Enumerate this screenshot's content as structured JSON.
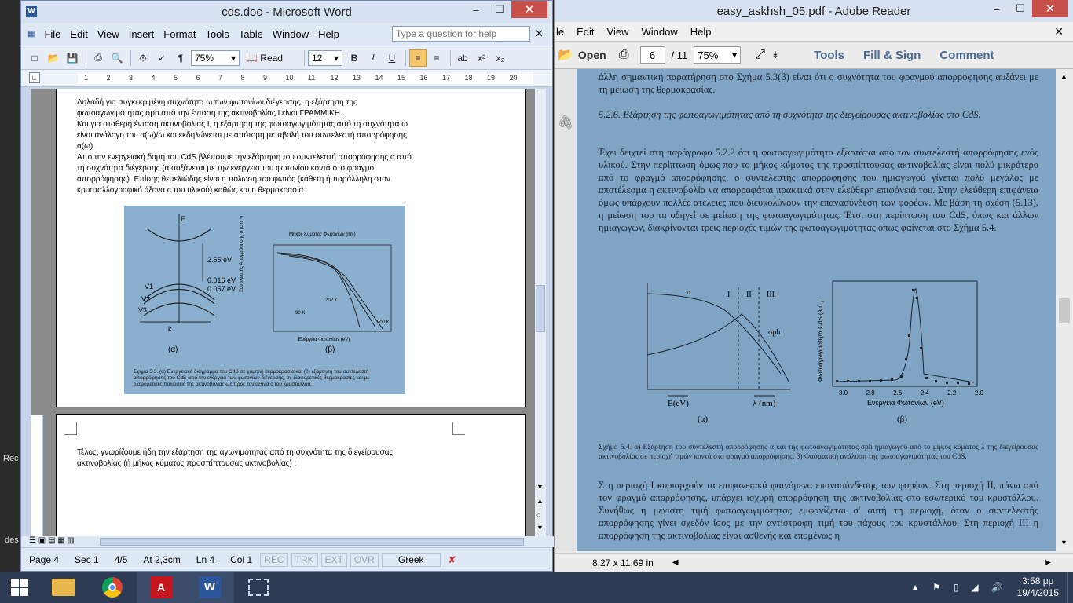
{
  "word": {
    "title": "cds.doc - Microsoft Word",
    "menu": [
      "File",
      "Edit",
      "View",
      "Insert",
      "Format",
      "Tools",
      "Table",
      "Window",
      "Help"
    ],
    "help_placeholder": "Type a question for help",
    "zoom": "75%",
    "read_label": "Read",
    "font_size": "12",
    "ruler_marks": [
      "1",
      "2",
      "3",
      "4",
      "5",
      "6",
      "7",
      "8",
      "9",
      "10",
      "11",
      "12",
      "13",
      "14",
      "15",
      "16",
      "17",
      "18",
      "19",
      "20"
    ],
    "page1_lines": [
      "Δηλαδή για συγκεκριμένη συχνότητα ω των φωτονίων διέγερσης, η εξάρτηση της",
      "φωτοαγωγιμότητας σph από την ένταση της ακτινοβολίας I είναι ΓΡΑΜΜΙΚΗ.",
      "Και για σταθερή ένταση ακτινοβολίας I, η εξάρτηση της φωτοαγωγιμότητας από τη συχνότητα ω",
      "είναι ανάλογη του α(ω)/ω  και εκδηλώνεται με απότομη μεταβολή του συντελεστή απορρόφησης",
      "α(ω).",
      "Από την ενεργειακή δομή του CdS βλέπουμε την εξάρτηση του συντελεστή απορρόφησης α από",
      "τη συχνότητα διέγερσης (α αυξάνεται με την ενέργεια του φωτονίου κοντά στο φραγμό",
      "απορρόφησης). Επίσης θεμελιώδης είναι η πόλωση του φωτός (κάθετη ή παράλληλη στον",
      "κρυσταλλογραφικό άξονα c του υλικού) καθώς και η θερμοκρασία."
    ],
    "figure": {
      "energy_label": "E",
      "gap1": "2.55 eV",
      "gap2": "0.016 eV",
      "gap3": "0.057 eV",
      "bands": [
        "V1",
        "V2",
        "V3"
      ],
      "k_label": "k",
      "sub_a": "(α)",
      "sub_b": "(β)",
      "top_axis": "Μήκος Κύματος Φωτονίων (nm)",
      "x_axis": "Ενέργεια Φωτονίων (eV)",
      "y_axis": "Συντελεστής Απορρόφησης α (cm⁻¹)",
      "temps": [
        "90 K",
        "202 K",
        "300 K"
      ],
      "caption": "Σχήμα 5.3. (α) Ενεργειακό διάγραμμα του CdS σε χαμηλή θερμοκρασία και (β) εξάρτηση του συντελεστή απορρόφησης του CdS από την ενέργεια των φωτονίων διέγερσης, σε διαφορετικές θερμοκρασίες και με διαφορετικές πολώσεις της ακτινοβολίας ως προς τον άξονα c του κρυστάλλου."
    },
    "page2_lines": [
      "Τέλος, γνωρίζουμε ήδη την εξάρτηση της αγωγιμότητας από τη συχνότητα της διεγείρουσας",
      "ακτινοβολίας (ή μήκος κύματος προσπίπτουσας ακτινοβολίας) :"
    ],
    "status": {
      "page": "Page 4",
      "sec": "Sec 1",
      "pages": "4/5",
      "at": "At 2,3cm",
      "ln": "Ln 4",
      "col": "Col 1",
      "rec": "REC",
      "trk": "TRK",
      "ext": "EXT",
      "ovr": "OVR",
      "lang": "Greek"
    }
  },
  "adobe": {
    "title": "easy_askhsh_05.pdf - Adobe Reader",
    "menu": [
      "le",
      "Edit",
      "View",
      "Window",
      "Help"
    ],
    "open_label": "Open",
    "page_num": "6",
    "page_total": "/ 11",
    "zoom": "75%",
    "tools": "Tools",
    "fill_sign": "Fill & Sign",
    "comment": "Comment",
    "para_top": "άλλη σημαντική παρατήρηση στο Σχήμα 5.3(β) είναι ότι ο συχνότητα του φραγμού απορρόφησης αυξάνει με τη μείωση της θερμοκρασίας.",
    "section_title": "5.2.6. Εξάρτηση της φωτοαγωγιμότητας από τη συχνότητα της διεγείρουσας ακτινοβολίας στο CdS.",
    "para_main": "Έχει δειχτεί στη παράγραφο 5.2.2 ότι η φωτοαγωγιμότητα εξαρτάται από τον συντελεστή απορρόφησης ενός υλικού. Στην περίπτωση όμως που το μήκος κύματος της προσπίπτουσας ακτινοβολίας είναι πολύ μικρότερο από το φραγμό απορρόφησης, ο συντελεστής απορρόφησης του ημιαγωγού γίνεται πολύ μεγάλος με αποτέλεσμα η ακτινοβολία να απορροφάται πρακτικά στην ελεύθερη επιφάνειά του. Στην ελεύθερη επιφάνεια όμως υπάρχουν πολλές ατέλειες που διευκολύνουν την επανασύνδεση των φορέων. Με βάση τη σχέση (5.13), η μείωση του τn οδηγεί σε μείωση της φωτοαγωγιμότητας. Έτσι στη περίπτωση του CdS, όπως και άλλων ημιαγωγών, διακρίνονται τρεις περιοχές τιμών της φωτοαγωγιμότητας όπως φαίνεται στο Σχήμα 5.4.",
    "fig_left": {
      "alpha": "α",
      "regions": [
        "I",
        "II",
        "III"
      ],
      "sigma": "σph",
      "x1": "E(eV)",
      "x2": "λ (nm)",
      "sub": "(α)"
    },
    "fig_right": {
      "y_axis": "Φωτοαγωγιμότητα CdS (a.u.)",
      "x_axis": "Ενέργεια Φωτονίων (eV)",
      "ticks": [
        "3.0",
        "2.8",
        "2.6",
        "2.4",
        "2.2",
        "2.0"
      ],
      "sub": "(β)"
    },
    "caption": "Σχήμα 5.4.  α) Εξάρτηση του συντελεστή απορρόφησης α και της φωτοαγωγιμότητας σph ημιαγωγού από το μήκος κύματος λ της διεγείρουσας ακτινοβολίας σε περιοχή τιμών κοντά στο φραγμό απορρόφησης. β) Φασματική ανάλυση της φωτοαγωγιμότητας του CdS.",
    "para_bottom": "Στη περιοχή I κυριαρχούν τα επιφανειακά φαινόμενα επανασύνδεσης των φορέων. Στη περιοχή II, πάνω από τον φραγμό απορρόφησης, υπάρχει ισχυρή απορρόφηση της ακτινοβολίας στο εσωτερικό του κρυστάλλου. Συνήθως η μέγιστη τιμή φωτοαγωγιμότητας εμφανίζεται σ' αυτή τη περιοχή, όταν ο συντελεστής απορρόφησης γίνει σχεδόν ίσος με την αντίστροφη τιμή του πάχους του κρυστάλλου. Στη περιοχή III η απορρόφηση της ακτινοβολίας είναι ασθενής και επομένως η",
    "status_size": "8,27 x 11,69 in"
  },
  "desktop": {
    "frag1": "Rec",
    "frag2": "des"
  },
  "taskbar": {
    "time": "3:58 μμ",
    "date": "19/4/2015"
  }
}
